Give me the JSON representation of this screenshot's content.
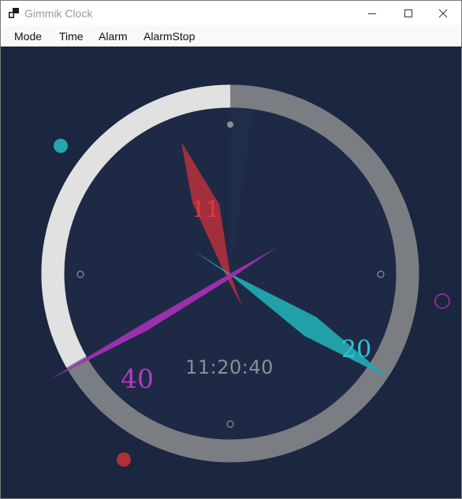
{
  "window": {
    "title": "Gimmik Clock",
    "app_icon": "app-window-icon",
    "controls": {
      "minimize": "minimize-icon",
      "maximize": "maximize-icon",
      "close": "close-icon"
    }
  },
  "menu": {
    "items": [
      "Mode",
      "Time",
      "Alarm",
      "AlarmStop"
    ]
  },
  "clock": {
    "digital_time": "11:20:40",
    "hour_label": "11",
    "minute_label": "20",
    "second_label": "40",
    "second_progress": 0.667
  },
  "colors": {
    "background": "#1b2640",
    "face": "#1e2a45",
    "ring_elapsed": "#e1e1e1",
    "ring_remaining": "#7a7d82",
    "hour_hand": "#b0303a",
    "hour_label": "#e0393f",
    "minute_hand": "#23a7b0",
    "minute_label": "#2cc7d2",
    "second_hand": "#a22fb3",
    "second_label": "#b838c8",
    "digital_text": "#8a8e97"
  }
}
